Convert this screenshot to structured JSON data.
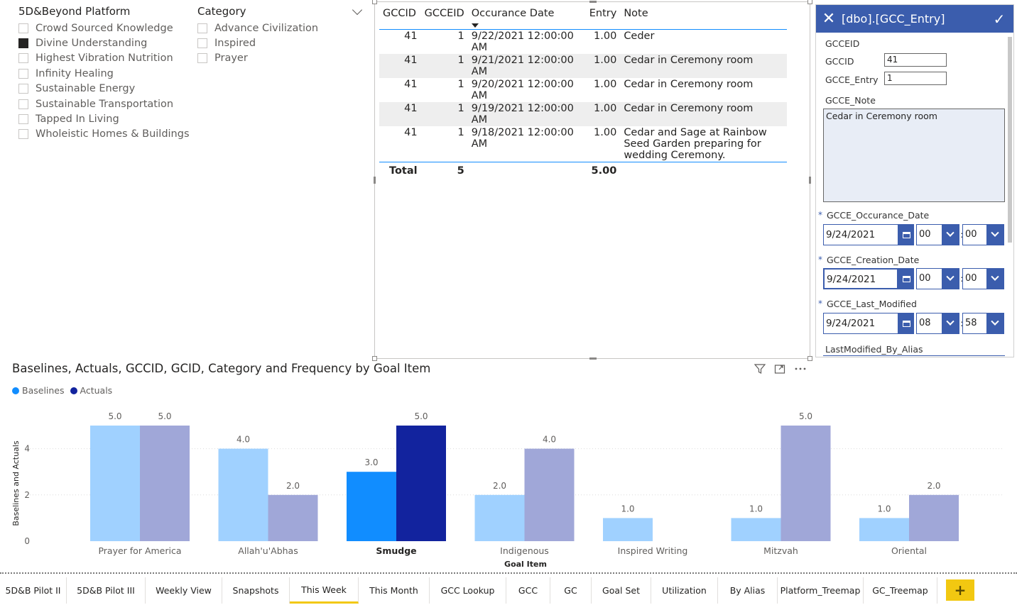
{
  "slicers": {
    "platform": {
      "title": "5D&Beyond Platform",
      "items": [
        {
          "label": "Crowd Sourced Knowledge",
          "checked": false
        },
        {
          "label": "Divine Understanding",
          "checked": true
        },
        {
          "label": "Highest Vibration Nutrition",
          "checked": false
        },
        {
          "label": "Infinity Healing",
          "checked": false
        },
        {
          "label": "Sustainable Energy",
          "checked": false
        },
        {
          "label": "Sustainable Transportation",
          "checked": false
        },
        {
          "label": "Tapped In Living",
          "checked": false
        },
        {
          "label": "Wholeistic Homes & Buildings",
          "checked": false
        }
      ]
    },
    "category": {
      "title": "Category",
      "items": [
        {
          "label": "Advance Civilization",
          "checked": false
        },
        {
          "label": "Inspired",
          "checked": false
        },
        {
          "label": "Prayer",
          "checked": false
        }
      ]
    }
  },
  "table": {
    "headers": [
      "GCCID",
      "GCCEID",
      "Occurance Date",
      "Entry",
      "Note"
    ],
    "rows": [
      [
        "41",
        "1",
        "9/22/2021 12:00:00 AM",
        "1.00",
        "Ceder"
      ],
      [
        "41",
        "1",
        "9/21/2021 12:00:00 AM",
        "1.00",
        "Cedar in Ceremony room"
      ],
      [
        "41",
        "1",
        "9/20/2021 12:00:00 AM",
        "1.00",
        "Cedar in Ceremony room"
      ],
      [
        "41",
        "1",
        "9/19/2021 12:00:00 AM",
        "1.00",
        "Cedar in Ceremony room"
      ],
      [
        "41",
        "1",
        "9/18/2021 12:00:00 AM",
        "1.00",
        "Cedar and Sage at Rainbow Seed Garden preparing for wedding Ceremony."
      ]
    ],
    "total": {
      "label": "Total",
      "gcceid": "5",
      "entry": "5.00"
    }
  },
  "form": {
    "title": "[dbo].[GCC_Entry]",
    "gcceid_label": "GCCEID",
    "gccid_label": "GCCID",
    "gccid_value": "41",
    "entry_label": "GCCE_Entry",
    "entry_value": "1",
    "note_label": "GCCE_Note",
    "note_value": "Cedar in Ceremony room",
    "required_mark": "*",
    "colon": ":",
    "occ_label": "GCCE_Occurance_Date",
    "occ_date": "9/24/2021",
    "occ_hour": "00",
    "occ_min": "00",
    "created_label": "GCCE_Creation_Date",
    "created_date": "9/24/2021",
    "created_hour": "00",
    "created_min": "00",
    "modified_label": "GCCE_Last_Modified",
    "modified_date": "9/24/2021",
    "modified_hour": "08",
    "modified_min": "58",
    "alias_label": "LastModified_By_Alias"
  },
  "chart_data": {
    "type": "bar",
    "title": "Baselines, Actuals, GCCID, GCID, Category and Frequency by Goal Item",
    "xlabel": "Goal Item",
    "ylabel": "Baselines and Actuals",
    "ylim": [
      0,
      5
    ],
    "yticks": [
      "0",
      "2",
      "4"
    ],
    "categories": [
      "Prayer for America",
      "Allah'u'Abhas",
      "Smudge",
      "Indigenous",
      "Inspired Writing",
      "Mitzvah",
      "Oriental"
    ],
    "highlighted_category": "Smudge",
    "series": [
      {
        "name": "Baselines",
        "values": [
          5.0,
          4.0,
          3.0,
          2.0,
          1.0,
          1.0,
          1.0
        ],
        "labels": [
          "5.0",
          "4.0",
          "3.0",
          "2.0",
          "1.0",
          "1.0",
          "1.0"
        ],
        "color": "#118dff",
        "dim_color": "#a0d1ff"
      },
      {
        "name": "Actuals",
        "values": [
          5.0,
          2.0,
          5.0,
          4.0,
          null,
          5.0,
          2.0
        ],
        "labels": [
          "5.0",
          "2.0",
          "5.0",
          "4.0",
          "",
          "5.0",
          "2.0"
        ],
        "color": "#12239e",
        "dim_color": "#a0a7d8"
      }
    ],
    "legend_position": "top-left",
    "grid": true
  },
  "tabs": {
    "items": [
      "5D&B Pilot II",
      "5D&B Pilot III",
      "Weekly View",
      "Snapshots",
      "This Week",
      "This Month",
      "GCC Lookup",
      "GCC",
      "GC",
      "Goal Set",
      "Utilization",
      "By Alias",
      "Platform_Treemap",
      "GC_Treemap"
    ],
    "active": "This Week",
    "add_label": "+"
  },
  "icons": {
    "filter": "filter-icon",
    "focus": "focus-mode-icon",
    "more": "more-options-icon",
    "close": "close-icon",
    "submit": "checkmark-icon",
    "calendar": "calendar-icon",
    "dropdown": "chevron-down-icon"
  }
}
